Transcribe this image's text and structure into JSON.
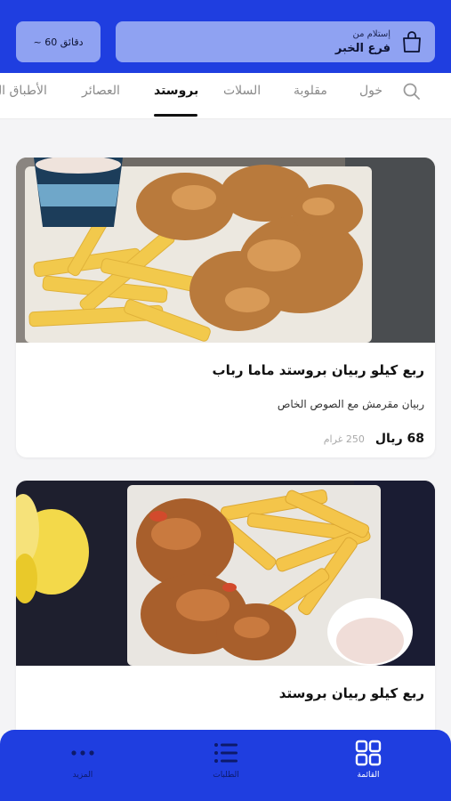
{
  "header": {
    "pickup_label": "إستلام من",
    "pickup_branch": "فرع الخبر",
    "time_estimate": "~ 60 دقائق"
  },
  "tabs": [
    {
      "label": "خول",
      "active": false
    },
    {
      "label": "مقلوبة",
      "active": false
    },
    {
      "label": "السلات",
      "active": false
    },
    {
      "label": "بروستد",
      "active": true
    },
    {
      "label": "العصائر",
      "active": false
    },
    {
      "label": "الأطباق ال",
      "active": false
    }
  ],
  "products": [
    {
      "title": "ربع كيلو ربيان بروستد ماما رباب",
      "description": "ربيان مقرمش مع الصوص الخاص",
      "price": "68 ريال",
      "weight": "250 غرام"
    },
    {
      "title": "ربع كيلو ربيان بروستد"
    }
  ],
  "bottom_nav": {
    "menu": "القائمة",
    "orders": "الطلبات",
    "more": "المزيد"
  },
  "colors": {
    "brand_blue": "#1f3ee0",
    "light_blue": "#8fa2f2"
  }
}
